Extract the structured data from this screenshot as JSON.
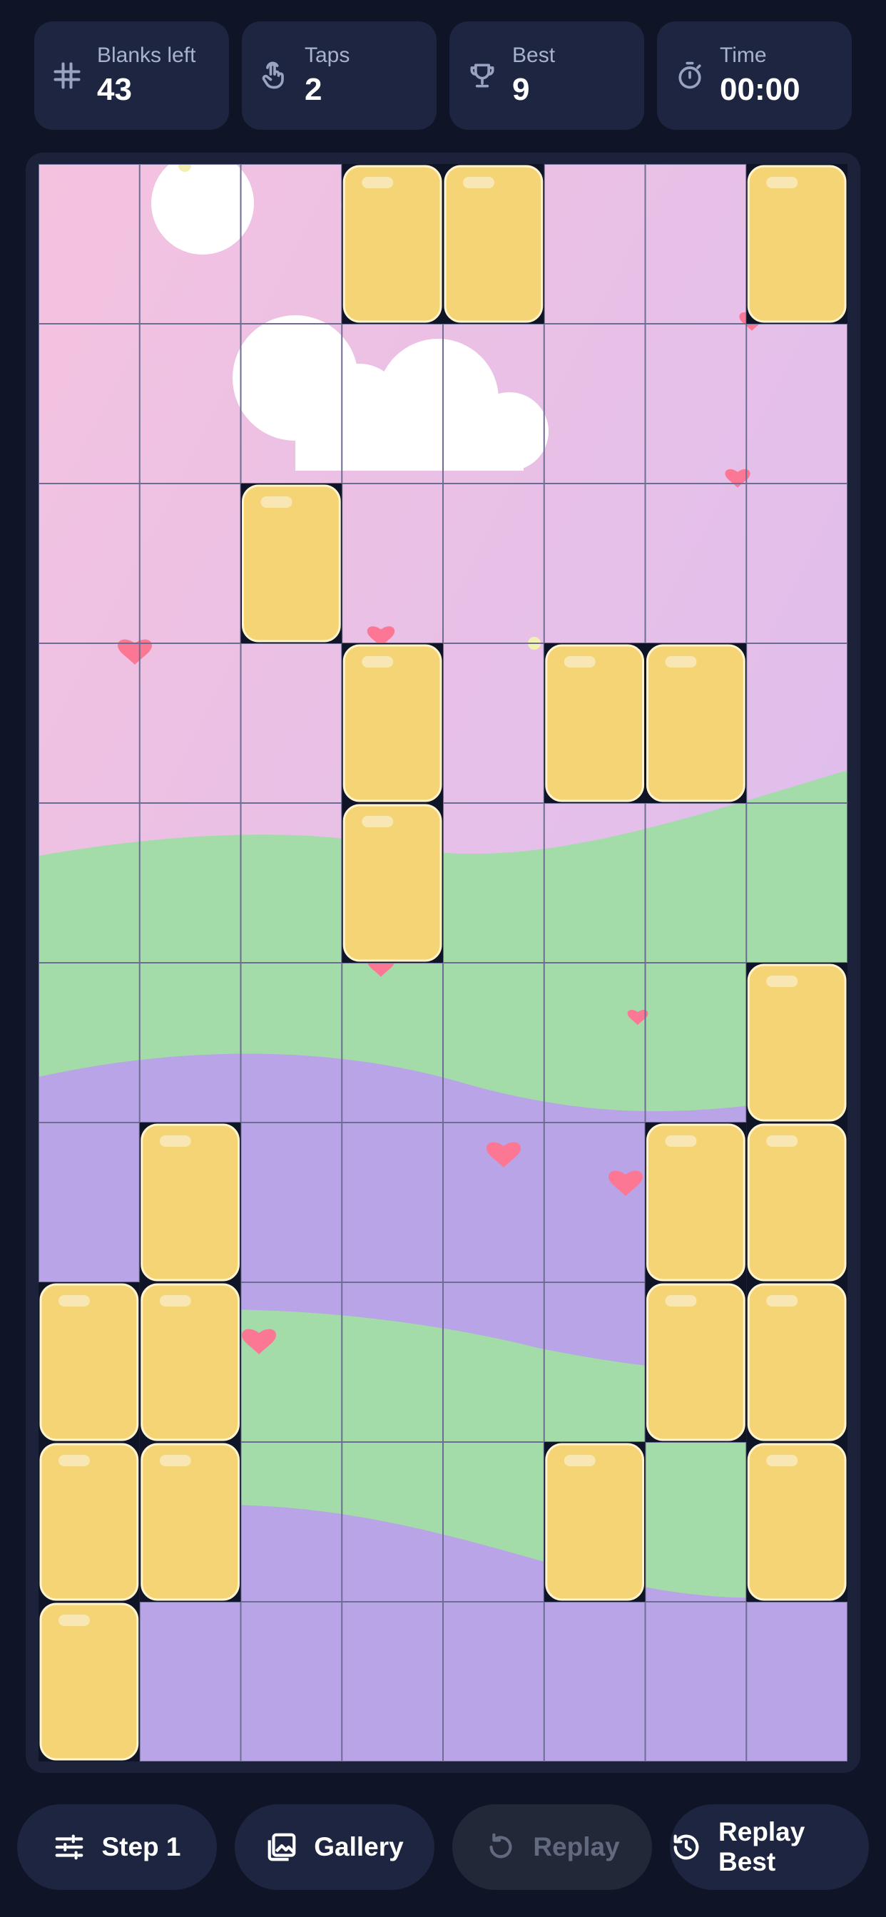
{
  "stats": {
    "blanks": {
      "label": "Blanks left",
      "value": "43",
      "icon": "grid-hash-icon"
    },
    "taps": {
      "label": "Taps",
      "value": "2",
      "icon": "tap-hand-icon"
    },
    "best": {
      "label": "Best",
      "value": "9",
      "icon": "trophy-icon"
    },
    "time": {
      "label": "Time",
      "value": "00:00",
      "icon": "stopwatch-icon"
    }
  },
  "board": {
    "columns": 8,
    "rows": 10,
    "blank_tiles": [
      [
        false,
        false,
        false,
        true,
        true,
        false,
        false,
        true
      ],
      [
        false,
        false,
        false,
        false,
        false,
        false,
        false,
        false
      ],
      [
        false,
        false,
        true,
        false,
        false,
        false,
        false,
        false
      ],
      [
        false,
        false,
        false,
        true,
        false,
        true,
        true,
        false
      ],
      [
        false,
        false,
        false,
        true,
        false,
        false,
        false,
        false
      ],
      [
        false,
        false,
        false,
        false,
        false,
        false,
        false,
        true
      ],
      [
        false,
        true,
        false,
        false,
        false,
        false,
        true,
        true
      ],
      [
        true,
        true,
        false,
        false,
        false,
        false,
        true,
        true
      ],
      [
        true,
        true,
        false,
        false,
        false,
        true,
        false,
        true
      ],
      [
        true,
        false,
        false,
        false,
        false,
        false,
        false,
        false
      ]
    ],
    "colors": {
      "tile": "#f5d475",
      "tile_border": "#fff4cf",
      "grid_line": "#6b6e92",
      "sky_top": "#f4c2df",
      "sky_bottom": "#d7bdf2",
      "hill_green": "#a3dca8",
      "hill_purple": "#b8a4e6",
      "heart": "#fb7793"
    }
  },
  "controls": {
    "step": {
      "label": "Step 1",
      "icon": "sliders-icon"
    },
    "gallery": {
      "label": "Gallery",
      "icon": "gallery-icon"
    },
    "replay": {
      "label": "Replay",
      "icon": "replay-icon",
      "disabled": true
    },
    "replay_best": {
      "label": "Replay Best",
      "icon": "history-icon"
    }
  }
}
